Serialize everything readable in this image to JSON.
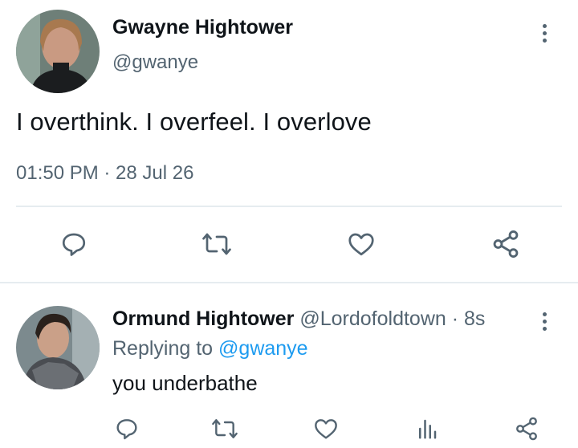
{
  "tweet": {
    "author": {
      "name": "Gwayne Hightower",
      "handle": "@gwanye"
    },
    "text": "I overthink. I overfeel. I overlove",
    "timestamp": "01:50 PM · 28 Jul 26",
    "actions": [
      "reply-icon",
      "retweet-icon",
      "like-icon",
      "share-icon"
    ]
  },
  "reply": {
    "author": {
      "name": "Ormund Hightower",
      "handle": "@Lordofoldtown"
    },
    "separator": "·",
    "time": "8s",
    "replying_prefix": "Replying to",
    "replying_to": "@gwanye",
    "text": "you underbathe",
    "actions": [
      "reply-icon",
      "retweet-icon",
      "like-icon",
      "analytics-icon",
      "share-icon"
    ]
  },
  "colors": {
    "text_primary": "#0f1419",
    "text_secondary": "#536471",
    "link": "#1d9bf0",
    "divider": "#e6ecf0"
  }
}
